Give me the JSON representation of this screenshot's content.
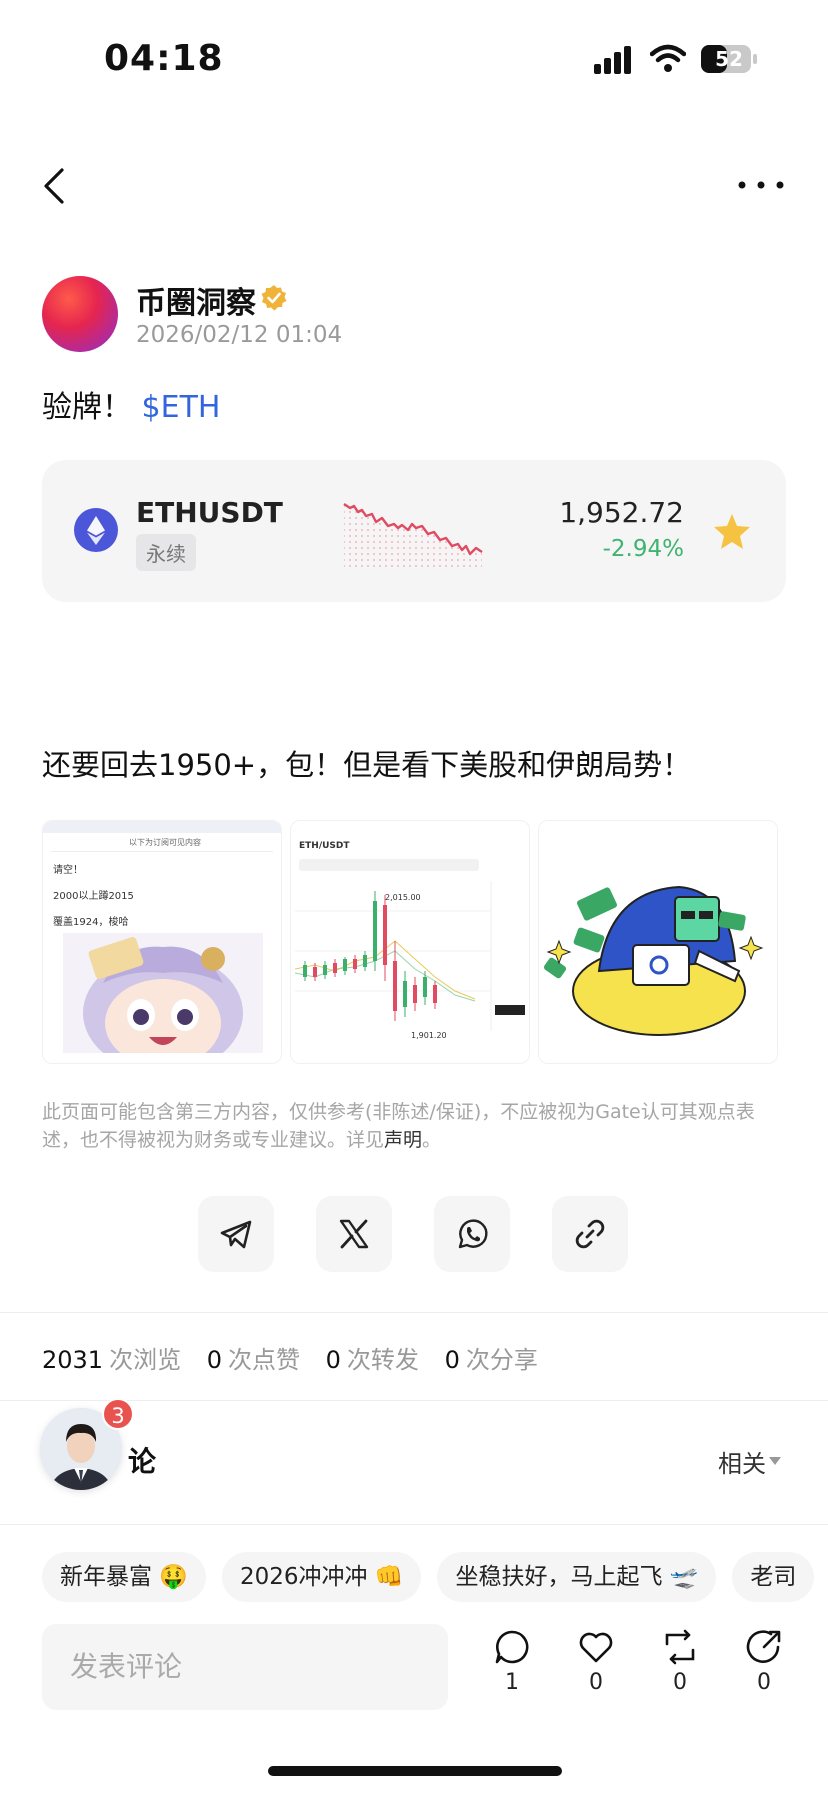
{
  "status": {
    "time": "04:18",
    "battery": "52"
  },
  "author": {
    "name": "币圈洞察",
    "timestamp": "2026/02/12 01:04"
  },
  "post": {
    "title_prefix": "验牌！",
    "title_tag": "$ETH",
    "body": "还要回去1950+，包！但是看下美股和伊朗局势！"
  },
  "ticker": {
    "symbol": "ETHUSDT",
    "type": "永续",
    "price": "1,952.72",
    "change": "-2.94%"
  },
  "images": {
    "img1": {
      "line1": "请空！",
      "line2": "2000以上蹲2015",
      "line3": "覆盖1924，梭哈",
      "header": "以下为订阅可见内容"
    },
    "img2": {
      "symbol": "ETH/USDT",
      "high": "2,015.00",
      "low": "1,901.20"
    }
  },
  "disclaimer": {
    "text": "此页面可能包含第三方内容，仅供参考(非陈述/保证)，不应被视为Gate认可其观点表述，也不得被视为财务或专业建议。详见",
    "link": "声明",
    "end": "。"
  },
  "stats": {
    "views": "2031",
    "views_label": "次浏览",
    "likes": "0",
    "likes_label": "次点赞",
    "reposts": "0",
    "reposts_label": "次转发",
    "shares": "0",
    "shares_label": "次分享"
  },
  "comments": {
    "title": "论",
    "badge": "3",
    "sort": "相关"
  },
  "tags": [
    "新年暴富 🤑",
    "2026冲冲冲 👊",
    "坐稳扶好，马上起飞 🛫",
    "老司"
  ],
  "bottom": {
    "placeholder": "发表评论",
    "comment_count": "1",
    "like_count": "0",
    "repost_count": "0",
    "share_count": "0"
  },
  "colors": {
    "link": "#3366dd",
    "negative": "#3fb36f",
    "badge": "#e9534f",
    "star": "#f5c242"
  }
}
